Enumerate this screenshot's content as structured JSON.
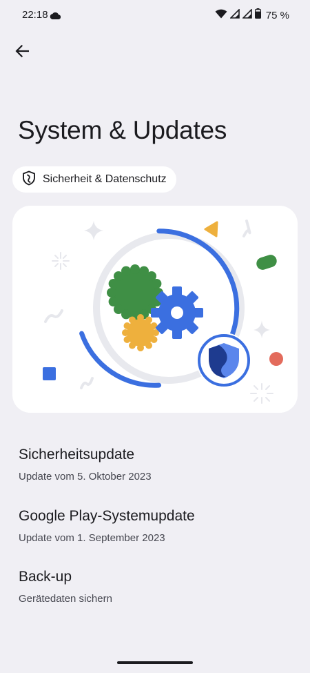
{
  "status_bar": {
    "time": "22:18",
    "battery_percent": "75 %",
    "icons": [
      "cloud-icon",
      "wifi-icon",
      "signal-icon",
      "signal-icon",
      "battery-icon"
    ]
  },
  "header": {
    "back_icon": "arrow-left-icon",
    "title": "System & Updates"
  },
  "chip": {
    "icon": "shield-icon",
    "label": "Sicherheit & Datenschutz"
  },
  "illustration": {
    "icons": [
      "gear-icon",
      "shield-icon"
    ]
  },
  "items": [
    {
      "title": "Sicherheitsupdate",
      "subtitle": "Update vom 5. Oktober 2023"
    },
    {
      "title": "Google Play-Systemupdate",
      "subtitle": "Update vom 1. September 2023"
    },
    {
      "title": "Back-up",
      "subtitle": "Gerätedaten sichern"
    }
  ],
  "colors": {
    "background": "#f0eff4",
    "card": "#ffffff",
    "accent_blue": "#3b6fe0",
    "green": "#3f8f45",
    "yellow": "#eeb03d",
    "red": "#e36b5c"
  }
}
